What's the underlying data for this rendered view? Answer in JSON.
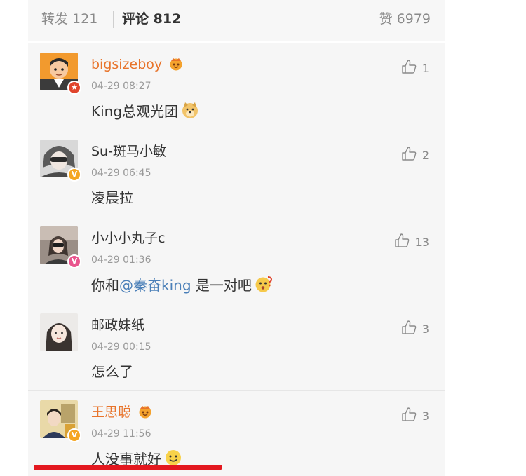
{
  "tabs": {
    "repost": "转发 121",
    "comments": "评论 812",
    "likes": "赞 6979"
  },
  "comments": [
    {
      "username": "bigsizeboy",
      "time": "04-29 08:27",
      "text": "King总观光团",
      "likes": "1",
      "emoji": "doge-emoji",
      "vip": "vip-crown-icon",
      "badge": "star-badge-icon"
    },
    {
      "username": "Su-斑马小敏",
      "time": "04-29 06:45",
      "text": "凌晨拉",
      "likes": "2",
      "badge": "verified-badge-icon"
    },
    {
      "username": "小小小丸子c",
      "time": "04-29 01:36",
      "text_before": "你和",
      "mention": "@秦奋king",
      "text_after": " 是一对吧",
      "likes": "13",
      "emoji": "wonder-emoji",
      "badge": "verified-badge-icon"
    },
    {
      "username": "邮政妹纸",
      "time": "04-29 00:15",
      "text": "怎么了",
      "likes": "3"
    },
    {
      "username": "王思聪",
      "time": "04-29 11:56",
      "text": "人没事就好",
      "likes": "3",
      "emoji": "smile-emoji",
      "vip": "vip-crown-icon",
      "badge": "verified-badge-icon"
    }
  ],
  "colors": {
    "username_highlight": "#e8742b",
    "username": "#333333",
    "meta": "#999999",
    "mention": "#4a7fb8",
    "markup_underline": "#e3181f",
    "background": "#f6f6f6"
  }
}
